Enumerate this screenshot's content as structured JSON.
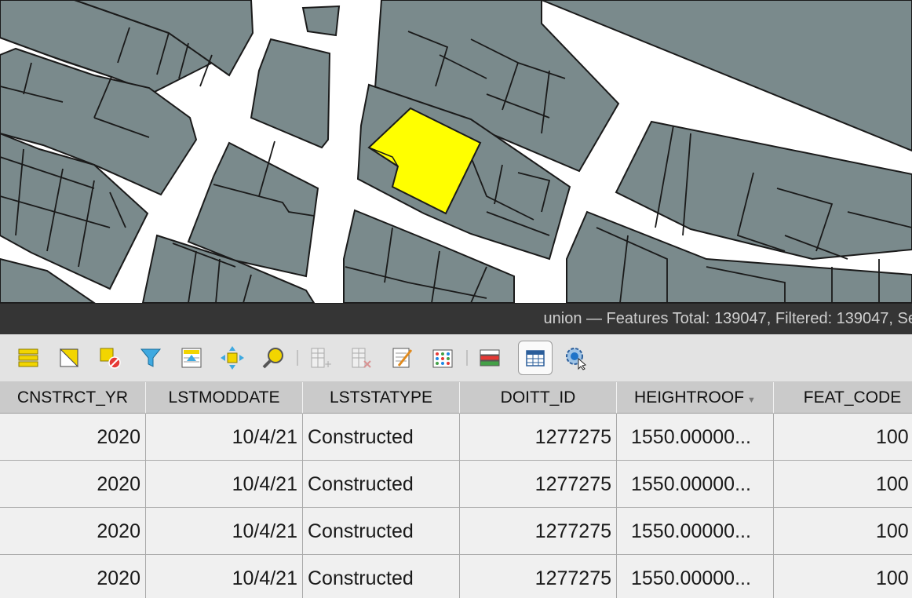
{
  "window": {
    "title": "union — Features Total: 139047, Filtered: 139047, Se"
  },
  "map": {
    "background_color": "#ffffff",
    "feature_color": "#7a8a8c",
    "selected_color": "#ffff00",
    "outline_color": "#1a1a1a"
  },
  "toolbar": {
    "buttons": [
      {
        "name": "select-all-icon"
      },
      {
        "name": "invert-selection-icon"
      },
      {
        "name": "deselect-all-icon"
      },
      {
        "name": "filter-select-icon"
      },
      {
        "name": "move-selection-to-top-icon"
      },
      {
        "name": "pan-to-selected-icon"
      },
      {
        "name": "zoom-to-selected-icon"
      },
      {
        "name": "new-field-icon"
      },
      {
        "name": "delete-field-icon"
      },
      {
        "name": "open-field-calculator-icon"
      },
      {
        "name": "conditional-formatting-icon"
      },
      {
        "name": "dock-attribute-table-icon"
      },
      {
        "name": "table-view-icon",
        "active": true
      },
      {
        "name": "actions-icon"
      }
    ]
  },
  "table": {
    "columns": [
      "CNSTRCT_YR",
      "LSTMODDATE",
      "LSTSTATYPE",
      "DOITT_ID",
      "HEIGHTROOF",
      "FEAT_CODE"
    ],
    "sort_column": "HEIGHTROOF",
    "sort_indicator": "▼",
    "rows": [
      [
        "2020",
        "10/4/21",
        "Constructed",
        "1277275",
        "1550.00000...",
        "100"
      ],
      [
        "2020",
        "10/4/21",
        "Constructed",
        "1277275",
        "1550.00000...",
        "100"
      ],
      [
        "2020",
        "10/4/21",
        "Constructed",
        "1277275",
        "1550.00000...",
        "100"
      ],
      [
        "2020",
        "10/4/21",
        "Constructed",
        "1277275",
        "1550.00000...",
        "100"
      ]
    ]
  }
}
